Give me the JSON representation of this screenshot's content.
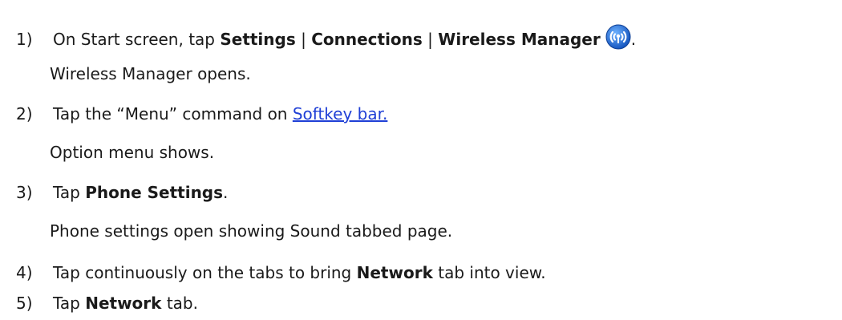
{
  "steps": [
    {
      "num": "1)",
      "pre": "On Start screen, tap ",
      "b1": "Settings",
      "sep1": " | ",
      "b2": "Connections",
      "sep2": " | ",
      "b3": "Wireless Manager",
      "icon": "wireless-manager-icon",
      "post": ".",
      "result": "Wireless Manager opens."
    },
    {
      "num": "2)",
      "pre": "Tap the “Menu” command on ",
      "link": "Softkey bar",
      "post": ".",
      "result": "Option menu shows."
    },
    {
      "num": "3)",
      "pre": "Tap ",
      "bold": "Phone Settings",
      "post": ".",
      "result": "Phone settings open showing Sound tabbed page."
    },
    {
      "num": "4)",
      "pre": "Tap continuously on the tabs to bring ",
      "bold": "Network",
      "post": " tab into view."
    },
    {
      "num": "5)",
      "pre": "Tap ",
      "bold": "Network",
      "post": " tab."
    }
  ],
  "colors": {
    "link": "#1f3fd6",
    "icon_ring": "#1e6fd9",
    "icon_center": "#ffffff"
  }
}
